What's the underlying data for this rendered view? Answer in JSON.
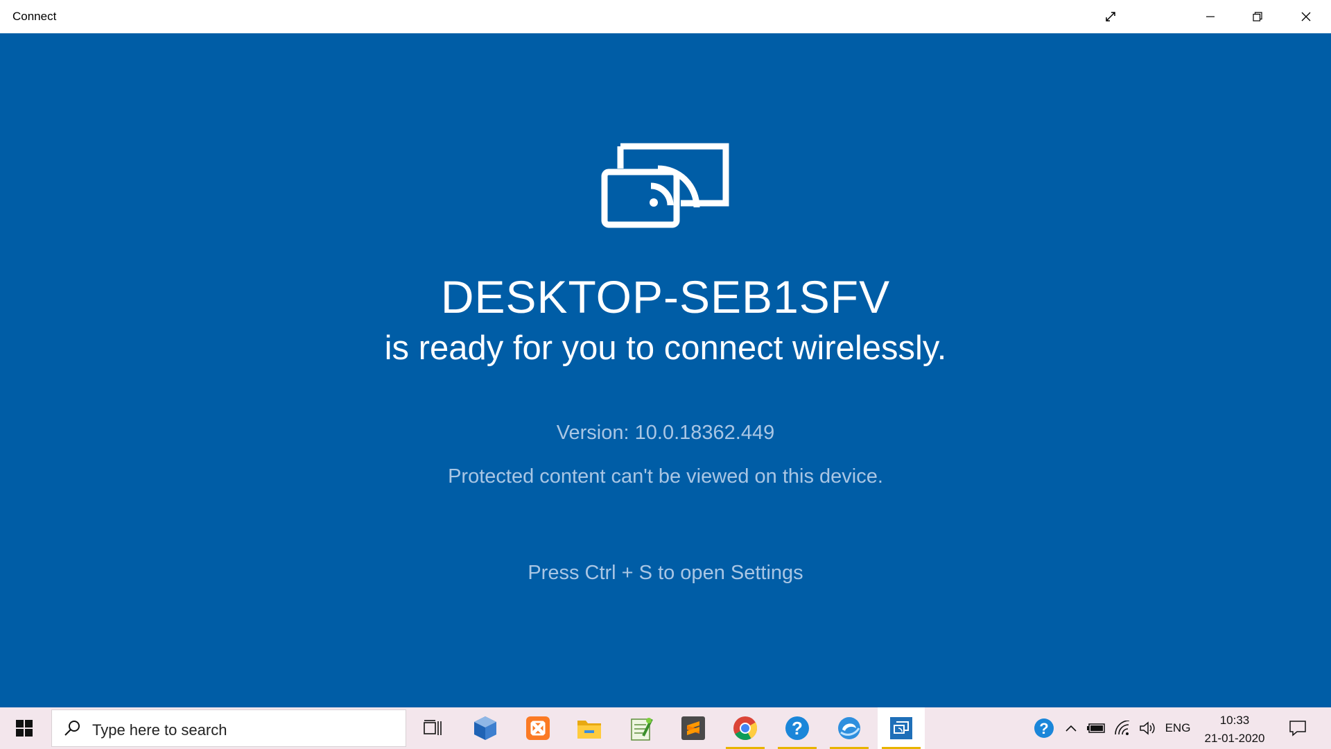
{
  "window": {
    "title": "Connect",
    "controls": [
      "fullscreen-icon",
      "minimize-icon",
      "restore-icon",
      "close-icon"
    ]
  },
  "main": {
    "device_name": "DESKTOP-SEB1SFV",
    "ready_text": "is ready for you to connect wirelessly.",
    "version_text": "Version: 10.0.18362.449",
    "protected_text": "Protected content can't be viewed on this device.",
    "settings_hint": "Press Ctrl + S to open Settings"
  },
  "colors": {
    "background": "#005da6",
    "secondary_text": "#a9c6e4",
    "taskbar": "#f3e6ec",
    "running_indicator": "#e8b400"
  },
  "taskbar": {
    "search_placeholder": "Type here to search",
    "apps": [
      {
        "icon": "task-view-icon",
        "running": false
      },
      {
        "icon": "virtualbox-icon",
        "running": false
      },
      {
        "icon": "xampp-icon",
        "running": false
      },
      {
        "icon": "file-explorer-icon",
        "running": false
      },
      {
        "icon": "notepad-icon",
        "running": false
      },
      {
        "icon": "sublime-text-icon",
        "running": false
      },
      {
        "icon": "chrome-icon",
        "running": true
      },
      {
        "icon": "help-icon",
        "running": true
      },
      {
        "icon": "browser-icon",
        "running": true
      },
      {
        "icon": "connect-icon",
        "running": true,
        "active": true
      }
    ],
    "tray": {
      "language": "ENG",
      "time": "10:33",
      "date": "21-01-2020"
    }
  }
}
